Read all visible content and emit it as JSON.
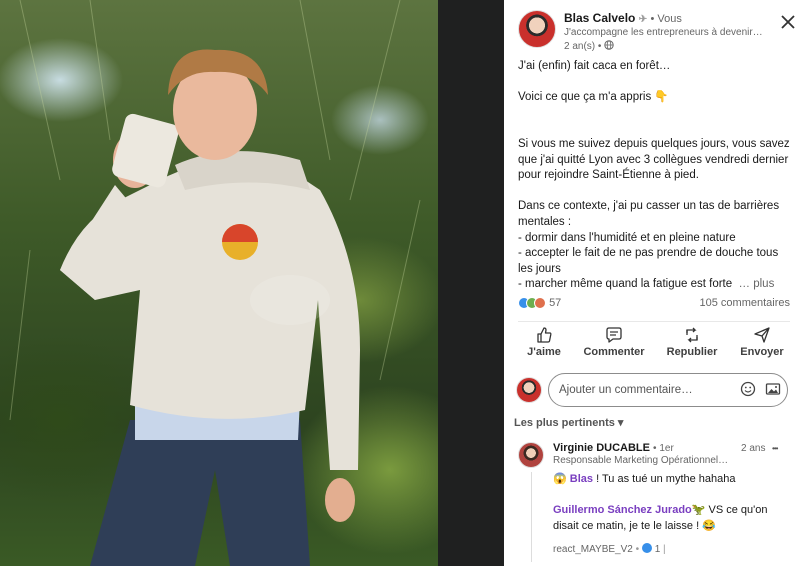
{
  "post": {
    "author": {
      "name": "Blas Calvelo",
      "badge": "• Vous",
      "headline": "J'accompagne les entrepreneurs à devenir…",
      "time": "2 an(s) •"
    },
    "text": {
      "p1": "J'ai (enfin) fait caca en forêt…",
      "p2": "Voici ce que ça m'a appris 👇",
      "p3": "Si vous me suivez depuis quelques jours, vous savez que j'ai quitté Lyon avec 3 collègues vendredi dernier pour rejoindre Saint-Étienne à pied.",
      "p4": "Dans ce contexte, j'ai pu casser un tas de barrières mentales :\n- dormir dans l'humidité et en pleine nature\n- accepter le fait de ne pas prendre de douche tous les jours\n- marcher même quand la fatigue est forte",
      "more": "… plus"
    },
    "reactions_count": "57",
    "comments_count": "105 commentaires"
  },
  "actions": {
    "like": "J'aime",
    "comment": "Commenter",
    "repost": "Republier",
    "send": "Envoyer"
  },
  "comment_box": {
    "placeholder": "Ajouter un commentaire…"
  },
  "sort_label": "Les plus pertinents ▾",
  "comment": {
    "name": "Virginie DUCABLE",
    "degree": "• 1er",
    "time": "2 ans",
    "more": "•••",
    "headline": "Responsable Marketing Opérationnel …",
    "emoji1": "😱 ",
    "mention1": "Blas",
    "line1": " ! Tu as tué un mythe hahaha",
    "mention2": "Guillermo Sánchez Jurado",
    "line2": "🦖 VS ce qu'on disait ce matin, je te le laisse ! 😂",
    "footer": "react_MAYBE_V2",
    "footer_count": "1"
  },
  "colors": {
    "mention": "#7a3fc0",
    "like_blue": "#378fe9",
    "heart_red": "#df704d",
    "support_green": "#6dae4f"
  },
  "icons": [
    "close-icon",
    "globe-icon",
    "thumbs-up-icon",
    "comment-icon",
    "repost-icon",
    "send-icon",
    "emoji-icon",
    "image-icon"
  ]
}
